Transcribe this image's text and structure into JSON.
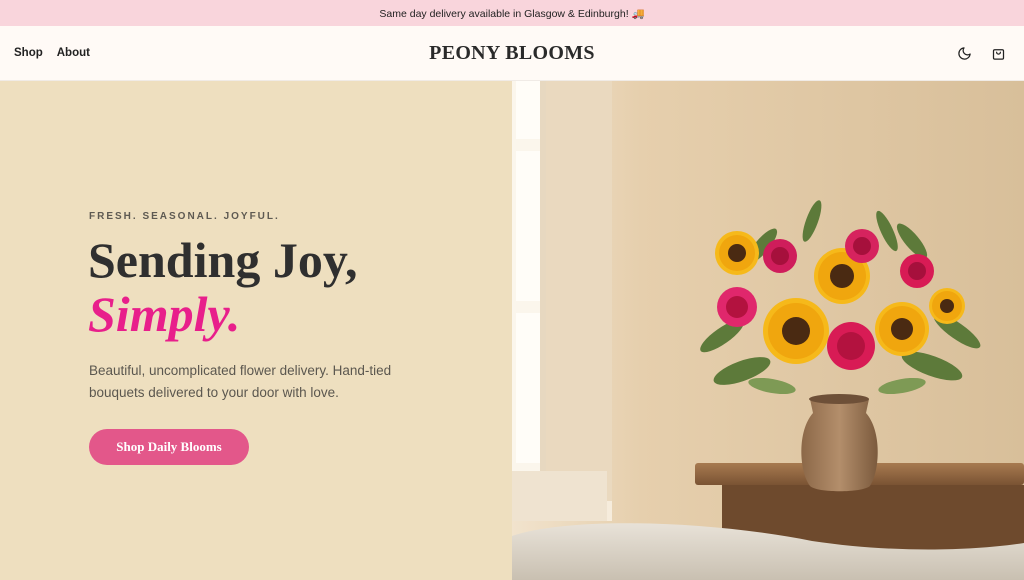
{
  "announcement": {
    "text": "Same day delivery available in Glasgow & Edinburgh! 🚚",
    "icon": "truck-icon"
  },
  "header": {
    "nav": [
      {
        "label": "Shop"
      },
      {
        "label": "About"
      }
    ],
    "brand": "PEONY BLOOMS",
    "icons": [
      "theme-toggle-icon",
      "bag-icon"
    ]
  },
  "hero": {
    "eyebrow": "FRESH. SEASONAL. JOYFUL.",
    "title_line1": "Sending Joy,",
    "title_line2": "Simply.",
    "description": "Beautiful, uncomplicated flower delivery. Hand-tied bouquets delivered to your door with love.",
    "cta_label": "Shop Daily Blooms",
    "image": "sunflower-and-rose-bouquet-in-vase-on-wooden-table"
  },
  "colors": {
    "announcement_bg": "#f9d5dc",
    "hero_left_bg": "#eedfbf",
    "accent": "#e81f8b",
    "cta_bg": "#e3578a"
  }
}
